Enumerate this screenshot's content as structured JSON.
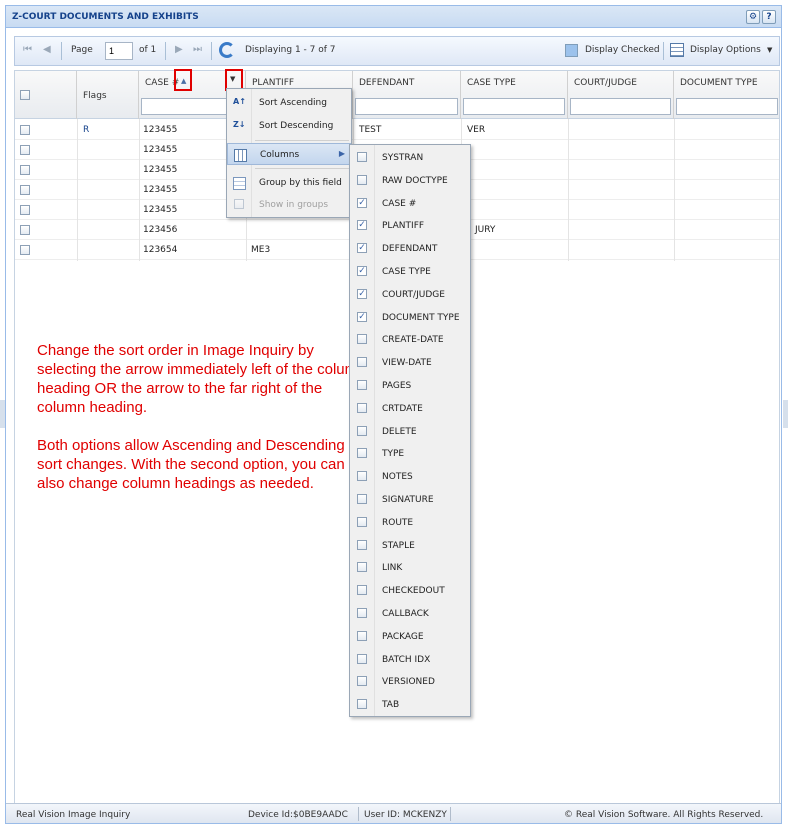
{
  "panel": {
    "title": "Z-COURT DOCUMENTS AND EXHIBITS",
    "gear_tool": "⚙",
    "help_tool": "?"
  },
  "toolbar": {
    "page_label": "Page",
    "page_value": "1",
    "of_label": "of 1",
    "displaying": "Displaying 1 - 7 of 7",
    "display_checked_label": "Display Checked",
    "display_options_label": "Display Options"
  },
  "grid": {
    "columns": [
      "",
      "Flags",
      "CASE #",
      "PLANTIFF",
      "DEFENDANT",
      "CASE TYPE",
      "COURT/JUDGE",
      "DOCUMENT TYPE"
    ],
    "rows": [
      {
        "flag": "R",
        "case": "123455",
        "plantiff": "",
        "defendant": "TEST",
        "case_type": "VER"
      },
      {
        "flag": "",
        "case": "123455",
        "plantiff": "",
        "defendant": "",
        "case_type": ""
      },
      {
        "flag": "",
        "case": "123455",
        "plantiff": "",
        "defendant": "",
        "case_type": ""
      },
      {
        "flag": "",
        "case": "123455",
        "plantiff": "",
        "defendant": "",
        "case_type": ""
      },
      {
        "flag": "",
        "case": "123455",
        "plantiff": "",
        "defendant": "",
        "case_type": ""
      },
      {
        "flag": "",
        "case": "123456",
        "plantiff": "",
        "defendant": "",
        "case_type": "JURY"
      },
      {
        "flag": "",
        "case": "123654",
        "plantiff": "ME3",
        "defendant": "",
        "case_type": ""
      }
    ]
  },
  "header_menu": {
    "sort_ascending": "Sort Ascending",
    "sort_descending": "Sort Descending",
    "columns": "Columns",
    "group_by": "Group by this field",
    "show_in_groups": "Show in groups"
  },
  "columns_menu": [
    {
      "label": "SYSTRAN",
      "checked": false
    },
    {
      "label": "RAW DOCTYPE",
      "checked": false
    },
    {
      "label": "CASE #",
      "checked": true
    },
    {
      "label": "PLANTIFF",
      "checked": true
    },
    {
      "label": "DEFENDANT",
      "checked": true
    },
    {
      "label": "CASE TYPE",
      "checked": true
    },
    {
      "label": "COURT/JUDGE",
      "checked": true
    },
    {
      "label": "DOCUMENT TYPE",
      "checked": true
    },
    {
      "label": "CREATE-DATE",
      "checked": false
    },
    {
      "label": "VIEW-DATE",
      "checked": false
    },
    {
      "label": "PAGES",
      "checked": false
    },
    {
      "label": "CRTDATE",
      "checked": false
    },
    {
      "label": "DELETE",
      "checked": false
    },
    {
      "label": "TYPE",
      "checked": false
    },
    {
      "label": "NOTES",
      "checked": false
    },
    {
      "label": "SIGNATURE",
      "checked": false
    },
    {
      "label": "ROUTE",
      "checked": false
    },
    {
      "label": "STAPLE",
      "checked": false
    },
    {
      "label": "LINK",
      "checked": false
    },
    {
      "label": "CHECKEDOUT",
      "checked": false
    },
    {
      "label": "CALLBACK",
      "checked": false
    },
    {
      "label": "PACKAGE",
      "checked": false
    },
    {
      "label": "BATCH IDX",
      "checked": false
    },
    {
      "label": "VERSIONED",
      "checked": false
    },
    {
      "label": "TAB",
      "checked": false
    }
  ],
  "instructions": {
    "para1": "Change the sort order in Image Inquiry by selecting the arrow immediately left of the column heading OR the arrow to the far right of the column heading.",
    "para2": "Both options allow Ascending and Descending sort changes. With the second option, you can also change column headings as needed."
  },
  "status": {
    "app": "Real Vision Image Inquiry",
    "device": "Device Id:$0BE9AADC",
    "user": "User ID: MCKENZY",
    "copyright": "© Real Vision Software. All Rights Reserved."
  },
  "colors": {
    "accent": "#15428b",
    "annotation": "#e00000",
    "header_bg": "#c8dbf2"
  }
}
